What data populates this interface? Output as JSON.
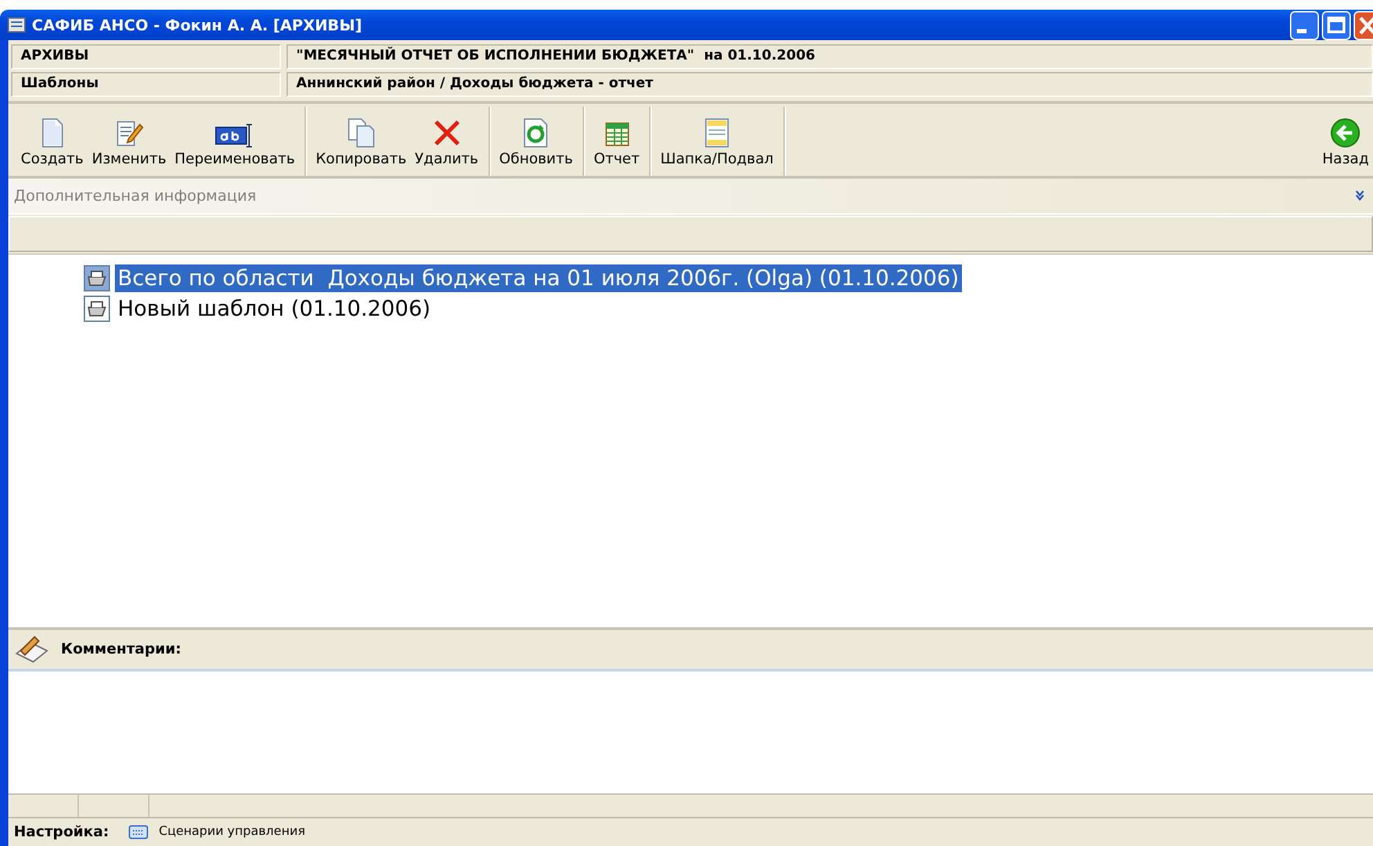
{
  "window": {
    "title": "САФИБ АНСО - Фокин А. А. [АРХИВЫ]"
  },
  "header": [
    {
      "label": "АРХИВЫ",
      "value": "\"МЕСЯЧНЫЙ ОТЧЕТ ОБ ИСПОЛНЕНИИ БЮДЖЕТА\"  на 01.10.2006"
    },
    {
      "label": "Шаблоны",
      "value": "Аннинский район / Доходы бюджета - отчет"
    }
  ],
  "toolbar": [
    [
      {
        "label": "Создать",
        "kind": "new"
      },
      {
        "label": "Изменить",
        "kind": "edit"
      },
      {
        "label": "Переименовать",
        "kind": "rename"
      }
    ],
    [
      {
        "label": "Копировать",
        "kind": "copy"
      },
      {
        "label": "Удалить",
        "kind": "delete"
      }
    ],
    [
      {
        "label": "Обновить",
        "kind": "refresh"
      }
    ],
    [
      {
        "label": "Отчет",
        "kind": "report"
      }
    ],
    [
      {
        "label": "Шапка/Подвал",
        "kind": "header"
      }
    ]
  ],
  "back_button": {
    "label": "Назад"
  },
  "info_panel": {
    "title": "Дополнительная информация",
    "expanded": false
  },
  "tree": [
    {
      "label": "Всего по области  Доходы бюджета на 01 июля 2006г. (Olga) (01.10.2006)",
      "selected": true
    },
    {
      "label": "Новый шаблон (01.10.2006)",
      "selected": false
    }
  ],
  "comments": {
    "title": "Комментарии:"
  },
  "status_bar": {
    "label": "Настройка:",
    "item": "Сценарии управления"
  }
}
